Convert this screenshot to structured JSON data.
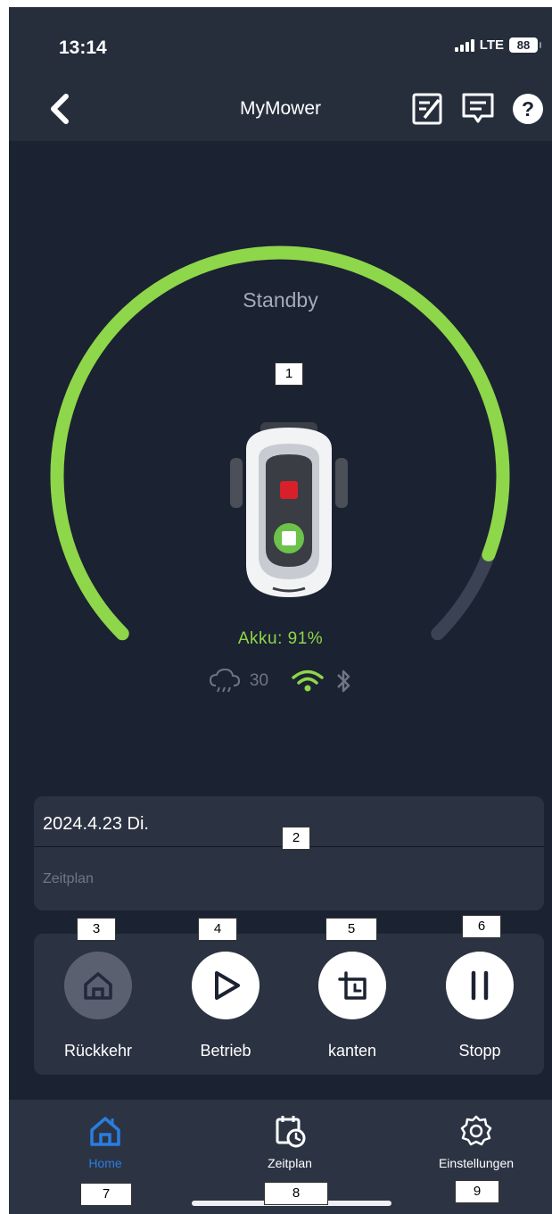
{
  "status_bar": {
    "time": "13:14",
    "network": "LTE",
    "battery": "88"
  },
  "header": {
    "title": "MyMower",
    "back_icon": "chevron-left-icon",
    "icons": [
      "edit-note-icon",
      "message-icon",
      "help-icon"
    ]
  },
  "gauge": {
    "state": "Standby",
    "battery_label": "Akku: 91%",
    "battery_level": 0.91,
    "rain_value": "30",
    "accent_color": "#8ed64a",
    "track_color": "#3a4253"
  },
  "schedule": {
    "date": "2024.4.23 Di.",
    "label": "Zeitplan"
  },
  "controls": [
    {
      "label": "Rückkehr",
      "icon": "home-icon"
    },
    {
      "label": "Betrieb",
      "icon": "play-icon"
    },
    {
      "label": "kanten",
      "icon": "edge-cut-icon"
    },
    {
      "label": "Stopp",
      "icon": "pause-icon"
    }
  ],
  "tabs": [
    {
      "label": "Home",
      "icon": "home-icon",
      "active": true
    },
    {
      "label": "Zeitplan",
      "icon": "calendar-clock-icon"
    },
    {
      "label": "Einstellungen",
      "icon": "gear-icon"
    }
  ],
  "markers": [
    "1",
    "2",
    "3",
    "4",
    "5",
    "6",
    "7",
    "8",
    "9"
  ],
  "colors": {
    "active_tab": "#2a7de1",
    "background": "#1b2231"
  }
}
